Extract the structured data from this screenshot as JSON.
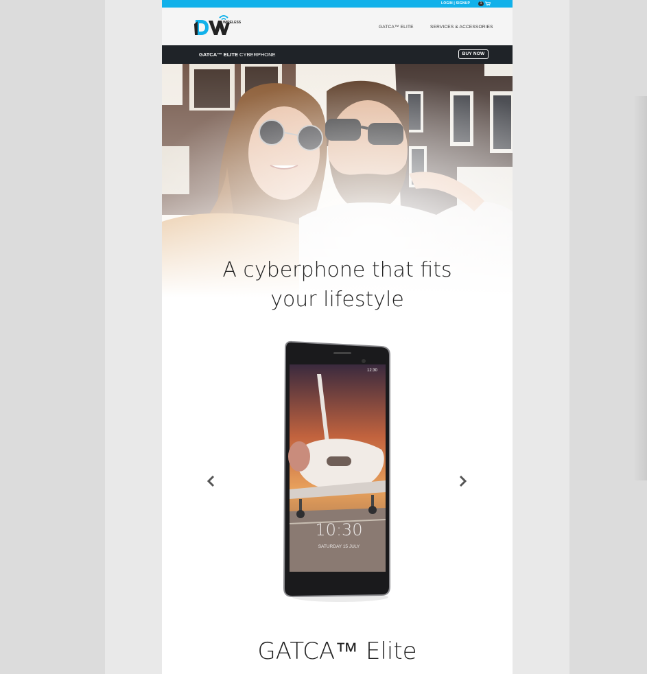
{
  "topbar": {
    "login_label": "LOGIN | SIGNUP",
    "cart_count": "1",
    "cart_icon": "cart-icon"
  },
  "header": {
    "logo_icon": "dw-wireless-logo",
    "nav": [
      {
        "label": "GATCA™ ELITE"
      },
      {
        "label": "SERVICES & ACCESSORIES"
      }
    ]
  },
  "subbar": {
    "title_bold": "GATCA™ ELITE",
    "title_rest": " CYBERPHONE",
    "buy_label": "BUY NOW"
  },
  "hero": {
    "image": "couple-selfie-photo",
    "headline_line1": "A cyberphone that fits",
    "headline_line2": "your lifestyle"
  },
  "carousel": {
    "prev_icon": "chevron-left-icon",
    "next_icon": "chevron-right-icon",
    "phone_image": "phone-product-image",
    "screen_time": "10:30",
    "screen_date": "SATURDAY 15 JULY",
    "status_time": "12:30"
  },
  "product": {
    "name": "GATCA™ Elite"
  },
  "colors": {
    "accent": "#11b1ea",
    "subbar": "#1f2328",
    "header": "#f5f5f5"
  }
}
